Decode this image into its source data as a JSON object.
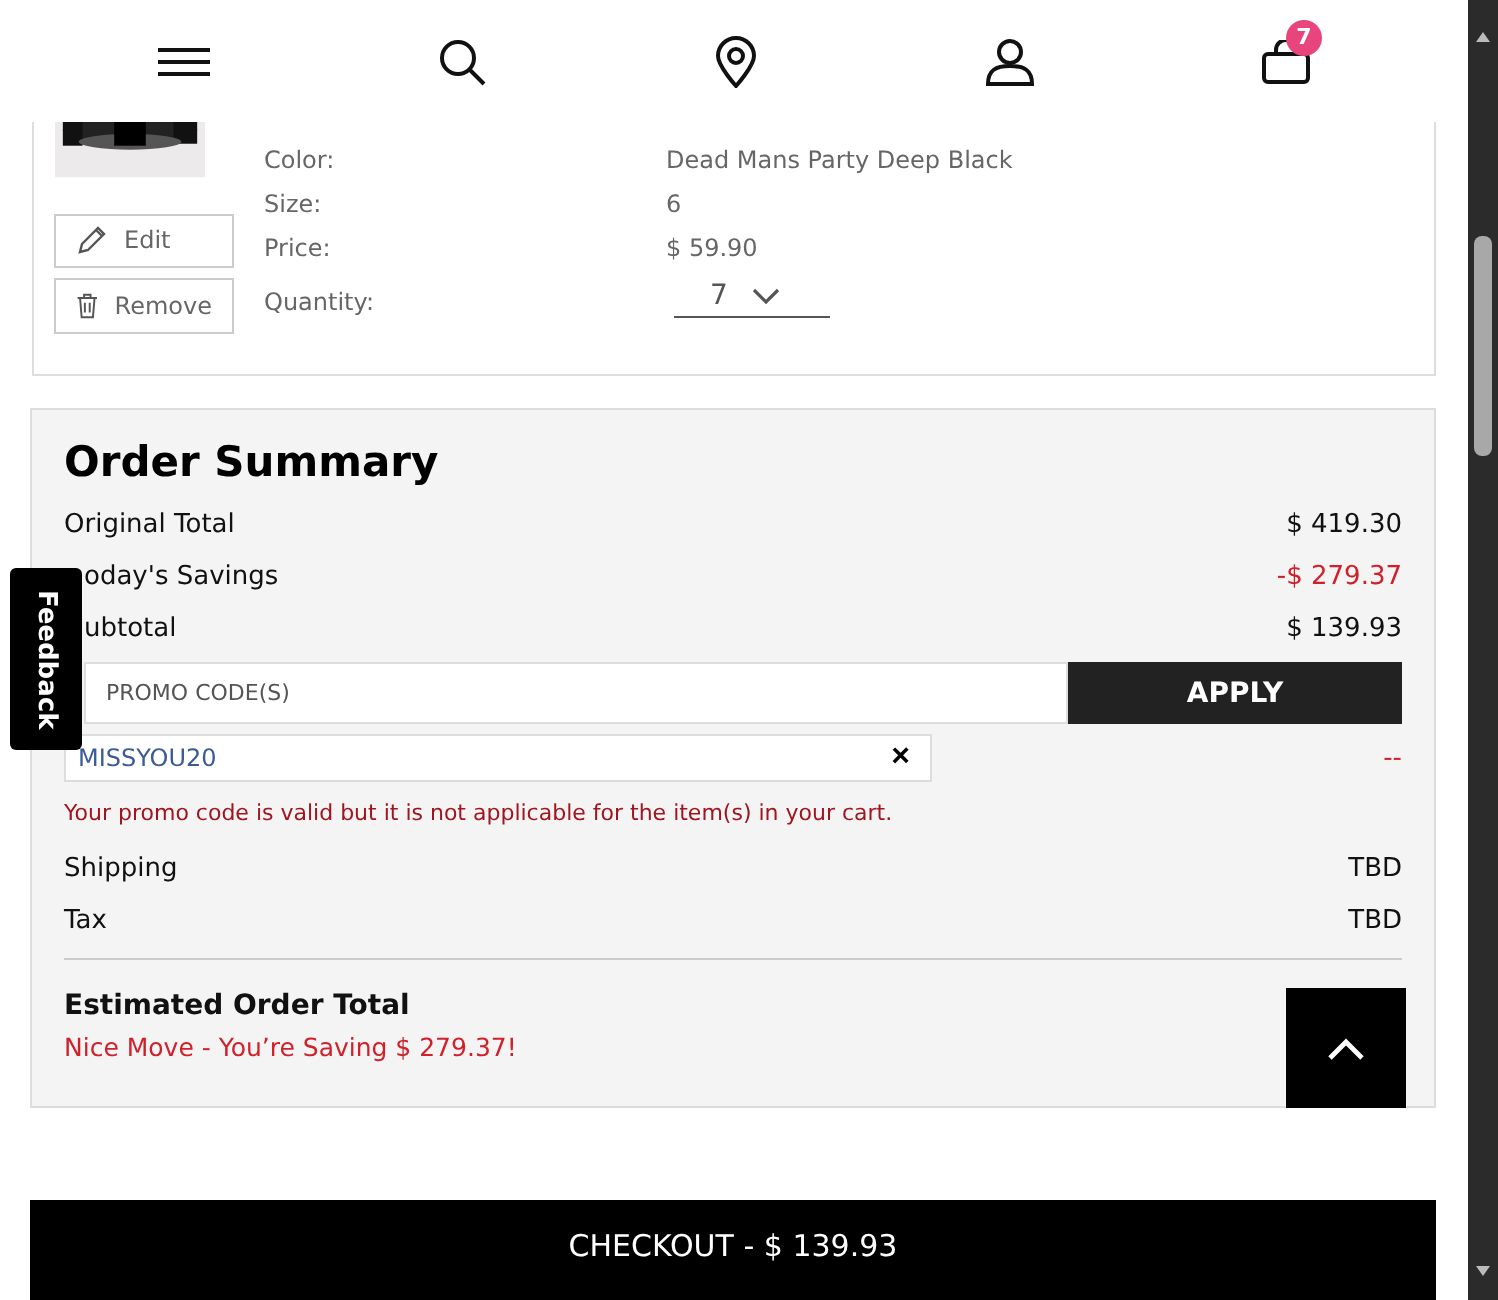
{
  "header": {
    "cart_count": "7"
  },
  "cart_item": {
    "details": [
      {
        "label": "Color:",
        "value": "Dead Mans Party Deep Black"
      },
      {
        "label": "Size:",
        "value": "6"
      },
      {
        "label": "Price:",
        "value": "$ 59.90"
      }
    ],
    "quantity": {
      "label": "Quantity:",
      "value": "7"
    },
    "actions": [
      {
        "kind": "edit",
        "label": "Edit"
      },
      {
        "kind": "remove",
        "label": "Remove"
      }
    ]
  },
  "order_summary": {
    "title": "Order Summary",
    "rows": [
      {
        "label": "Original Total",
        "value": "$ 419.30",
        "kind": "normal"
      },
      {
        "label": "oday's Savings",
        "value": "-$ 279.37",
        "kind": "discount"
      },
      {
        "label": "ubtotal",
        "value": "$ 139.93",
        "kind": "normal"
      }
    ],
    "promo": {
      "placeholder": "PROMO CODE(S)",
      "button": "APPLY",
      "applied_code": "MISSYOU20",
      "remove": "×",
      "discount": "--",
      "message": "Your promo code is valid but it is not applicable for the item(s) in your cart."
    },
    "extra_rows": [
      {
        "label": "Shipping",
        "value": "TBD"
      },
      {
        "label": "Tax",
        "value": "TBD"
      }
    ],
    "estimated": {
      "label": "Estimated Order Total",
      "savings_note": "Nice Move - You’re Saving $ 279.37!"
    }
  },
  "checkout": "CHECKOUT - $ 139.93",
  "feedback": "Feedback"
}
